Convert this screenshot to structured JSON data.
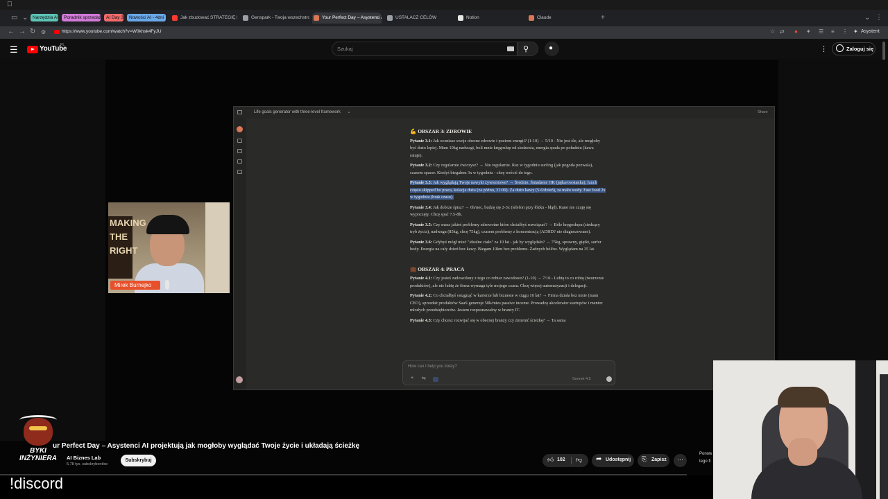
{
  "browser": {
    "tab_chips": [
      {
        "label": "Narzędzia AI",
        "color": "#5ec4b6"
      },
      {
        "label": "Poradnik sprzedaży",
        "color": "#d07ad6"
      },
      {
        "label": "AI Day 3",
        "color": "#f26b6b"
      },
      {
        "label": "Nowości AI - 4dni",
        "color": "#6aa8e8"
      }
    ],
    "tabs": [
      {
        "label": "Jak zbudować STRATEGIĘ biznesu",
        "icon_color": "#ff3b30",
        "active": false
      },
      {
        "label": "Genspark - Twoja wszechstronna",
        "icon_color": "#9aa0a6",
        "active": false
      },
      {
        "label": "Your Perfect Day – Asystenci AI",
        "icon_color": "#d97757",
        "active": true
      },
      {
        "label": "USTALACZ CELÓW",
        "icon_color": "#9aa0a6",
        "active": false
      },
      {
        "label": "Notion",
        "icon_color": "#e8e8e8",
        "active": false
      },
      {
        "label": "Claude",
        "icon_color": "#d97757",
        "active": false
      }
    ],
    "new_tab": "+",
    "url": "https://www.youtube.com/watch?v=W0khsk4FyJU",
    "assistant": "Asystent"
  },
  "youtube": {
    "logo_text": "YouTube",
    "country": "PL",
    "search_placeholder": "Szukaj",
    "sign_in": "Zaloguj się"
  },
  "claude": {
    "chat_title": "Life goals generator with three-level framework",
    "share": "Share",
    "input_placeholder": "How can I help you today?",
    "model": "Sonnet 4.5",
    "area3_title": "💪 OBSZAR 3: ZDROWIE",
    "area3": [
      {
        "q": "Pytanie 3.1:",
        "text": "Jak oceniasz swoje obecne zdrowie i poziom energii? (1-10) → 5/10 - Nie jest źle, ale mogłoby być dużo lepiej. Mam 10kg nadwagi, boli mnie kręgosłup od siedzenia, energia spada po południu (kawa ratuje).",
        "highlight": false
      },
      {
        "q": "Pytanie 3.2:",
        "text": "Czy regularnie ćwiczysz? → Nie regularnie. Raz w tygodniu surfing (jak pogoda pozwala), czasem spacer. Kiedyś biegałem 3x w tygodniu - chcę wrócić do tego.",
        "highlight": false
      },
      {
        "q": "Pytanie 3.3:",
        "text": "Jak wyglądają Twoje nawyki żywieniowe? → Średnio. Śniadanie OK (jajka/owsianka), lunch często skipped bo praca, kolacja duża (za późno, 21:00). Za dużo kawy (5-6/dzień), za mało wody. Fast food 2x w tygodniu (brak czasu).",
        "highlight": true
      },
      {
        "q": "Pytanie 3.4:",
        "text": "Jak dobrze śpisz? → 6h/noc, budzę się 2-3x (telefon przy łóżku - błąd). Rano nie czuję się wypoczęty. Chcę spać 7.5-8h.",
        "highlight": false
      },
      {
        "q": "Pytanie 3.5:",
        "text": "Czy masz jakieś problemy zdrowotne które chciałbyś rozwiązać? → Bóle kręgosłupa (siedzący tryb życia), nadwaga (85kg, chcę 75kg), czasem problemy z koncentracją (ADHD? nie diagnozowane).",
        "highlight": false
      },
      {
        "q": "Pytanie 3.6:",
        "text": "Gdybyś mógł mieć \"idealne ciało\" za 10 lat - jak by wyglądało? → 75kg, sprawny, giętki, surfer body. Energia na cały dzień bez kawy. Biegam 10km bez problemu. Żadnych bólów. Wyglądam na 35 lat.",
        "highlight": false
      }
    ],
    "area4_title": "💼 OBSZAR 4: PRACA",
    "area4": [
      {
        "q": "Pytanie 4.1:",
        "text": "Czy jesteś zadowolony z tego co robisz zawodowo? (1-10) → 7/10 - Lubię to co robię (tworzenie produktów), ale nie lubię że firma wymaga tyle mojego czasu. Chcę więcej automatyzacji i delegacji.",
        "highlight": false
      },
      {
        "q": "Pytanie 4.2:",
        "text": "Co chciałbyś osiągnąć w karierze lub biznesie w ciągu 10 lat? → Firma działa bez mnie (mam CEO), sprzedaż produktów SaaS generuje 50k/mies passive income. Prowadzę akcelerator startupów i mentor młodych przedsiębiorców. Jestem rozpoznawalny w branży IT.",
        "highlight": false
      },
      {
        "q": "Pytanie 4.3:",
        "text": "Czy chcesz rozwijać się w obecnej branży czy zmienić ścieżkę? → Ta sama",
        "highlight": false
      }
    ]
  },
  "presenter": {
    "name": "Mirek Burnejko",
    "poster_text": "MAKING THE RIGHT"
  },
  "video": {
    "title": "ur Perfect Day – Asystenci AI projektują jak mogłoby wyglądać Twoje życie i układają ścieżkę",
    "channel": "AI Biznes Lab",
    "subscribers": "5,78 tys. subskrybentów",
    "subscribe": "Subskrybuj",
    "likes": "102",
    "share": "Udostępnij",
    "save": "Zapisz",
    "more": "···",
    "side_note_1": "Ponow",
    "side_note_2": "tego fi"
  },
  "overlay": {
    "logo_text": "BYKI INŻYNIERA",
    "discord": "!discord"
  }
}
